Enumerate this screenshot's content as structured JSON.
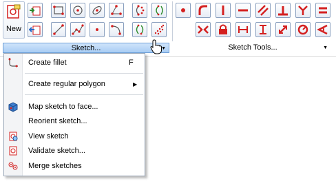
{
  "ribbon": {
    "new_label": "New",
    "sketch_group_label": "Sketch...",
    "sketch_tools_label": "Sketch Tools..."
  },
  "menu": {
    "create_fillet": {
      "label": "Create fillet",
      "shortcut": "F",
      "icon": "fillet-icon"
    },
    "regular_polygon": {
      "label": "Create regular polygon",
      "submenu_arrow": "▶",
      "icon": ""
    },
    "map_sketch": {
      "label": "Map sketch to face...",
      "icon": "map-sketch-icon"
    },
    "reorient": {
      "label": "Reorient sketch...",
      "icon": ""
    },
    "view_sketch": {
      "label": "View sketch",
      "icon": "view-sketch-icon"
    },
    "validate": {
      "label": "Validate sketch...",
      "icon": "validate-sketch-icon"
    },
    "merge": {
      "label": "Merge sketches",
      "icon": "merge-sketches-icon"
    }
  },
  "colors": {
    "accent_red": "#d42020",
    "highlight_blue": "#a9cdf4",
    "border_blue": "#6d9ed6"
  }
}
